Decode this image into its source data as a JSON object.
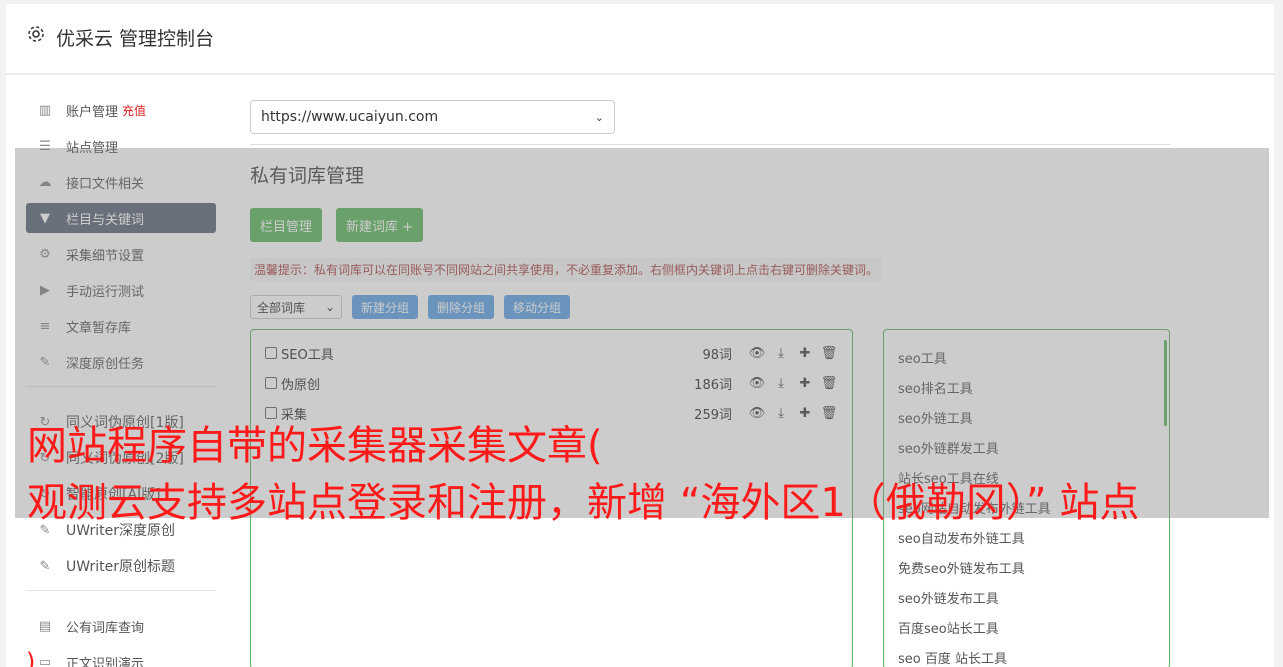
{
  "header": {
    "title": "优采云 管理控制台",
    "icon": "gear-icon"
  },
  "sidebar": {
    "items": [
      {
        "label": "账户管理",
        "extra": "充值",
        "icon": "bar-chart-icon"
      },
      {
        "label": "站点管理",
        "icon": "server-icon"
      },
      {
        "label": "接口文件相关",
        "icon": "cloud-upload-icon"
      },
      {
        "label": "栏目与关键词",
        "icon": "filter-icon",
        "active": true
      },
      {
        "label": "采集细节设置",
        "icon": "gears-icon"
      },
      {
        "label": "手动运行测试",
        "icon": "play-circle-icon"
      },
      {
        "label": "文章暂存库",
        "icon": "database-icon"
      },
      {
        "label": "深度原创任务",
        "icon": "edit-icon"
      }
    ],
    "items2": [
      {
        "label": "同义词伪原创[1版]",
        "icon": "refresh-icon"
      },
      {
        "label": "同义词伪原创[2版]",
        "icon": "refresh-icon"
      },
      {
        "label": "智能原创[AI版]",
        "icon": "refresh-icon"
      },
      {
        "label": "UWriter深度原创",
        "icon": "edit-icon"
      },
      {
        "label": "UWriter原创标题",
        "icon": "edit-icon"
      }
    ],
    "items3": [
      {
        "label": "公有词库查询",
        "icon": "book-icon"
      },
      {
        "label": "正文识别演示",
        "icon": "monitor-icon"
      }
    ]
  },
  "content": {
    "site_url": "https://www.ucaiyun.com",
    "section_title": "私有词库管理",
    "btn_column": "栏目管理",
    "btn_new_lib": "新建词库 +",
    "tip": "温馨提示：私有词库可以在同账号不同网站之间共享使用，不必重复添加。右侧框内关键词上点击右键可删除关键词。",
    "filter_select": "全部词库",
    "btn_new_group": "新建分组",
    "btn_delete_group": "删除分组",
    "btn_move_group": "移动分组",
    "libraries": [
      {
        "name": "SEO工具",
        "count": "98词"
      },
      {
        "name": "伪原创",
        "count": "186词"
      },
      {
        "name": "采集",
        "count": "259词"
      }
    ],
    "keywords": [
      "seo工具",
      "seo排名工具",
      "seo外链工具",
      "seo外链群发工具",
      "站长seo工具在线",
      "seo网站自动发布外链工具",
      "seo自动发布外链工具",
      "免费seo外链发布工具",
      "seo外链发布工具",
      "百度seo站长工具",
      "seo 百度 站长工具"
    ]
  },
  "overlay": {
    "line1": "网站程序自带的采集器采集文章(",
    "line2": "观测云支持多站点登录和注册，新增 “海外区1（俄勒冈）” 站点",
    "corner": ")"
  },
  "colors": {
    "accent": "#5cb85c",
    "active_nav": "#5b6779",
    "blue_btn": "#5ea2e6",
    "overlay_text": "#ff1a1a"
  }
}
